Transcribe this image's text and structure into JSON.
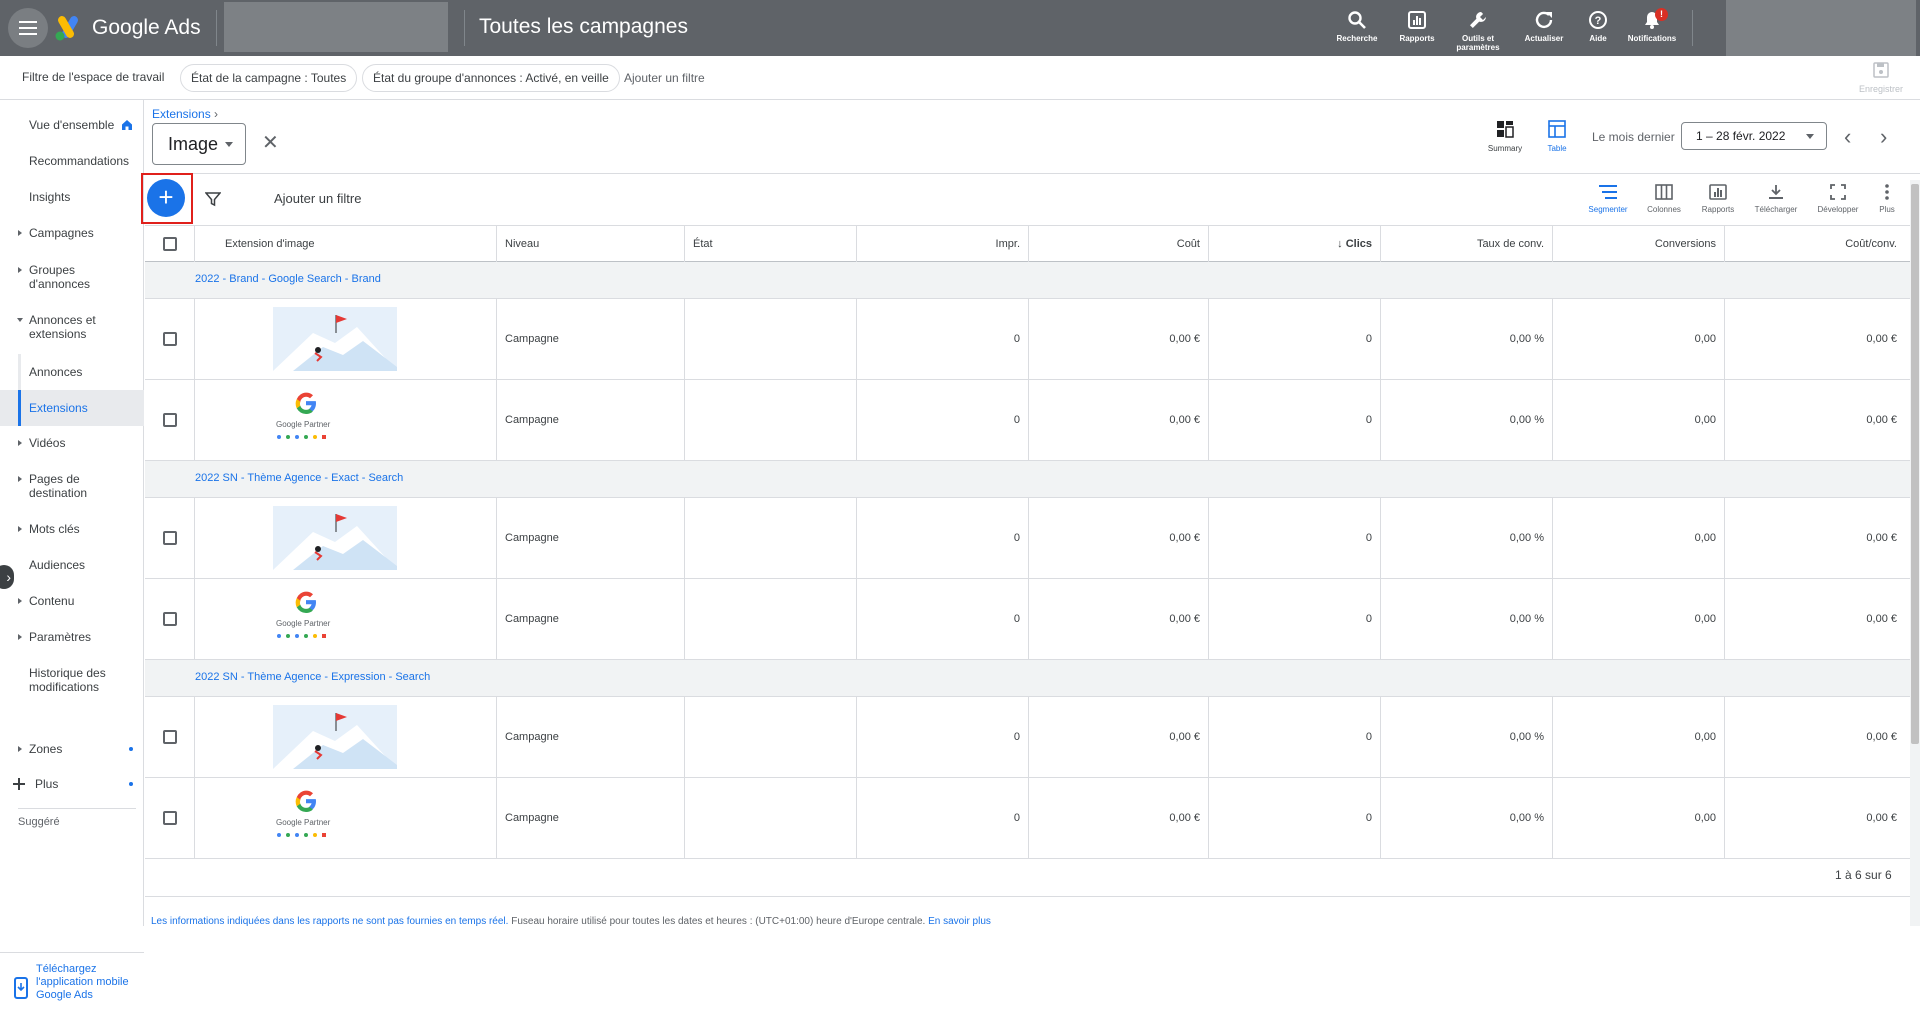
{
  "topbar": {
    "brand": "Google Ads",
    "page_title": "Toutes les campagnes",
    "tools": [
      {
        "label": "Recherche",
        "icon": "search-icon"
      },
      {
        "label": "Rapports",
        "icon": "reports-icon"
      },
      {
        "label": "Outils et paramètres",
        "icon": "wrench-icon"
      },
      {
        "label": "Actualiser",
        "icon": "refresh-icon"
      },
      {
        "label": "Aide",
        "icon": "help-icon"
      },
      {
        "label": "Notifications",
        "icon": "bell-icon",
        "badge": "!"
      }
    ]
  },
  "filterbar": {
    "workspace_label": "Filtre de l'espace de travail",
    "chips": [
      "État de la campagne : Toutes",
      "État du groupe d'annonces : Activé, en veille"
    ],
    "add_filter": "Ajouter un filtre",
    "save_label": "Enregistrer"
  },
  "sidebar": {
    "items": [
      {
        "label": "Vue d'ensemble",
        "icon": "home-icon"
      },
      {
        "label": "Recommandations"
      },
      {
        "label": "Insights"
      },
      {
        "label": "Campagnes"
      },
      {
        "label": "Groupes d'annonces"
      },
      {
        "label": "Annonces et extensions"
      },
      {
        "label": "Annonces"
      },
      {
        "label": "Extensions"
      },
      {
        "label": "Vidéos"
      },
      {
        "label": "Pages de destination"
      },
      {
        "label": "Mots clés"
      },
      {
        "label": "Audiences"
      },
      {
        "label": "Contenu"
      },
      {
        "label": "Paramètres"
      },
      {
        "label": "Historique des modifications"
      },
      {
        "label": "Zones"
      },
      {
        "label": "Plus"
      }
    ],
    "suggested_label": "Suggéré",
    "app_download": "Téléchargez l'application mobile Google Ads"
  },
  "main": {
    "breadcrumb": "Extensions",
    "type_select": "Image",
    "view_summary": "Summary",
    "view_table": "Table",
    "date_label": "Le mois dernier",
    "date_range": "1 – 28 févr. 2022",
    "add_filter": "Ajouter un filtre",
    "toolbar": [
      "Segmenter",
      "Colonnes",
      "Rapports",
      "Télécharger",
      "Développer",
      "Plus"
    ]
  },
  "table": {
    "columns": [
      "Extension d'image",
      "Niveau",
      "État",
      "Impr.",
      "Coût",
      "Clics",
      "Taux de conv.",
      "Conversions",
      "Coût/conv."
    ],
    "groups": [
      {
        "name": "2022 - Brand - Google Search - Brand",
        "rows": [
          {
            "image": "flag-image",
            "niveau": "Campagne",
            "etat": "",
            "impr": "0",
            "cout": "0,00 €",
            "clics": "0",
            "taux": "0,00 %",
            "conv": "0,00",
            "cout_conv": "0,00 €"
          },
          {
            "image": "google-partner-badge",
            "niveau": "Campagne",
            "etat": "",
            "impr": "0",
            "cout": "0,00 €",
            "clics": "0",
            "taux": "0,00 %",
            "conv": "0,00",
            "cout_conv": "0,00 €"
          }
        ]
      },
      {
        "name": "2022 SN - Thème Agence - Exact - Search",
        "rows": [
          {
            "image": "flag-image",
            "niveau": "Campagne",
            "etat": "",
            "impr": "0",
            "cout": "0,00 €",
            "clics": "0",
            "taux": "0,00 %",
            "conv": "0,00",
            "cout_conv": "0,00 €"
          },
          {
            "image": "google-partner-badge",
            "niveau": "Campagne",
            "etat": "",
            "impr": "0",
            "cout": "0,00 €",
            "clics": "0",
            "taux": "0,00 %",
            "conv": "0,00",
            "cout_conv": "0,00 €"
          }
        ]
      },
      {
        "name": "2022 SN - Thème Agence - Expression - Search",
        "rows": [
          {
            "image": "flag-image",
            "niveau": "Campagne",
            "etat": "",
            "impr": "0",
            "cout": "0,00 €",
            "clics": "0",
            "taux": "0,00 %",
            "conv": "0,00",
            "cout_conv": "0,00 €"
          },
          {
            "image": "google-partner-badge",
            "niveau": "Campagne",
            "etat": "",
            "impr": "0",
            "cout": "0,00 €",
            "clics": "0",
            "taux": "0,00 %",
            "conv": "0,00",
            "cout_conv": "0,00 €"
          }
        ]
      }
    ],
    "badge_text": "Google Partner",
    "pagination": "1 à 6 sur 6"
  },
  "footer": {
    "text_link": "Les informations indiquées dans les rapports ne sont pas fournies en temps réel.",
    "text": " Fuseau horaire utilisé pour toutes les dates et heures : (UTC+01:00) heure d'Europe centrale. ",
    "learn_more": "En savoir plus"
  },
  "colors": {
    "accent": "#1a73e8",
    "topbar": "#5f6368",
    "highlight": "#e0201b"
  }
}
